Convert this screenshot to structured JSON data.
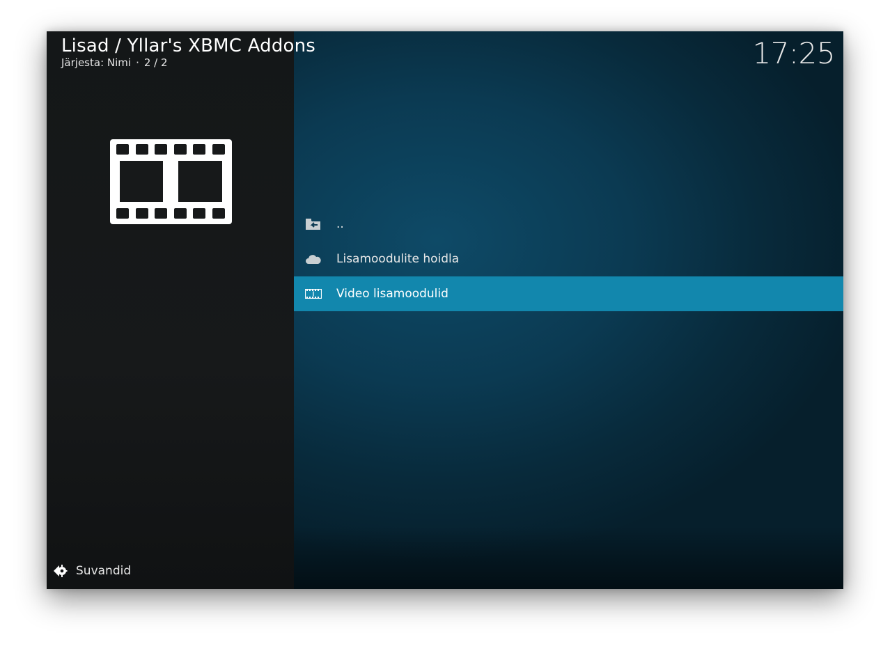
{
  "header": {
    "title": "Lisad / Yllar's XBMC Addons",
    "sort_label": "Järjesta: Nimi",
    "separator": "·",
    "position": "2 / 2",
    "clock": "17:25"
  },
  "preview": {
    "icon": "film-strip-icon"
  },
  "list": {
    "items": [
      {
        "label": "..",
        "icon": "folder-back-icon"
      },
      {
        "label": "Lisamoodulite hoidla",
        "icon": "cloud-icon"
      },
      {
        "label": "Video lisamoodulid",
        "icon": "film-strip-icon",
        "focused": true
      }
    ]
  },
  "footer": {
    "options_label": "Suvandid",
    "options_icon": "options-arrow-icon"
  },
  "colors": {
    "focus": "#1287ad",
    "left_panel": "#17191a",
    "background": "#0b3a52"
  }
}
